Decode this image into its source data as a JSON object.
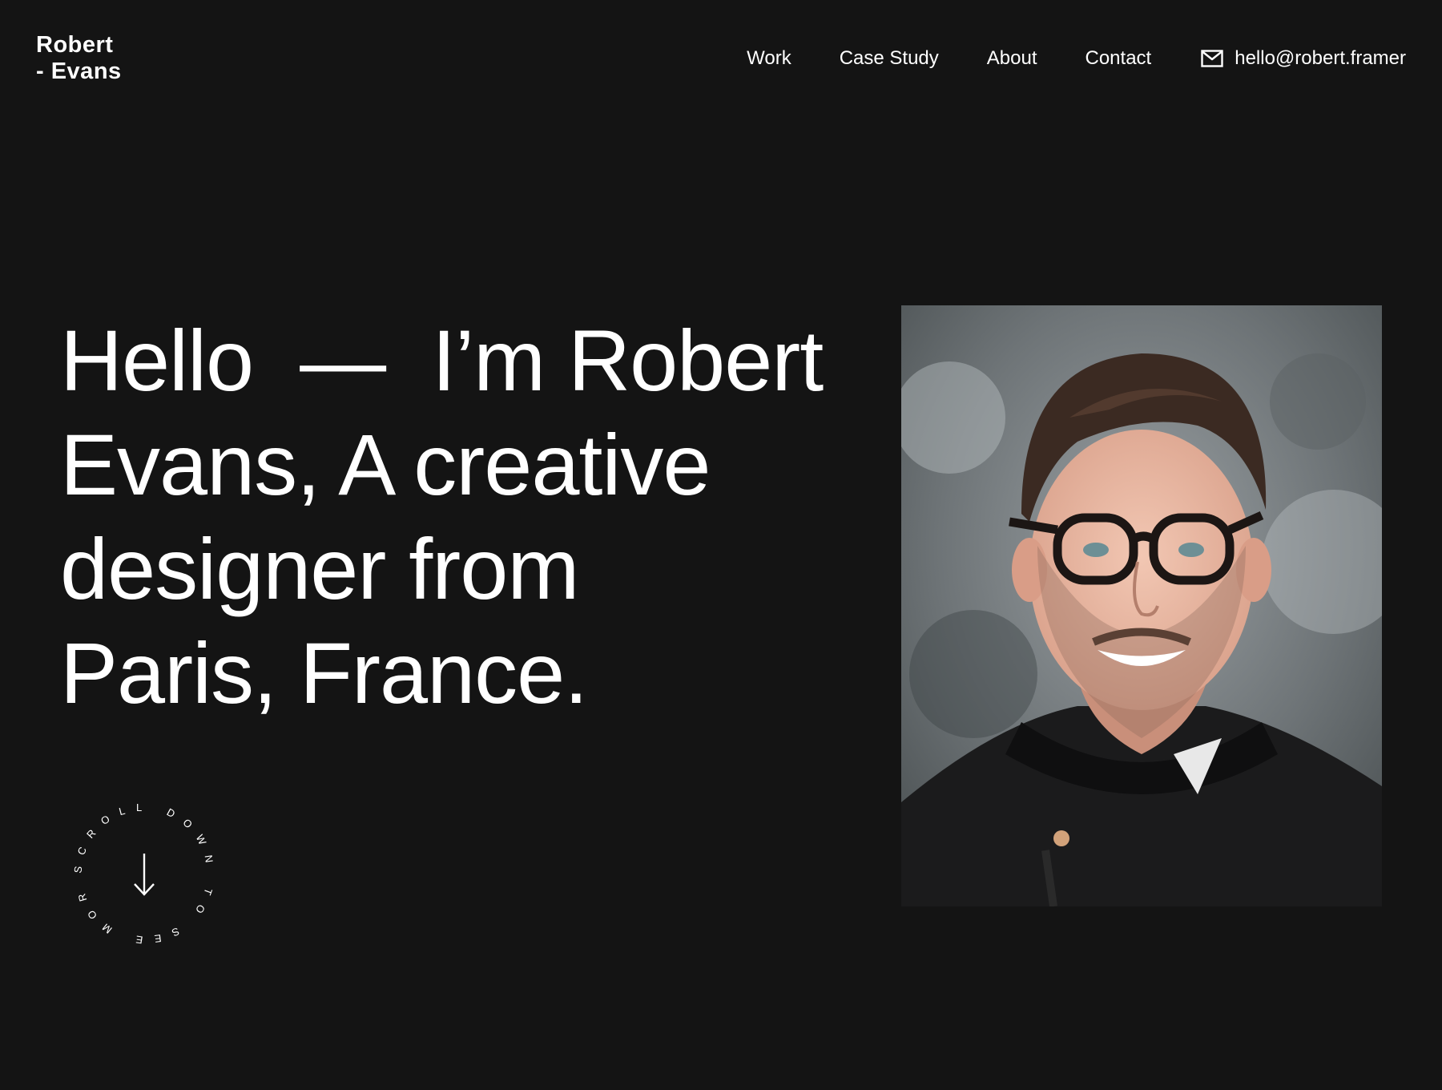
{
  "logo": {
    "line1": "Robert",
    "line2": "- Evans"
  },
  "nav": {
    "items": [
      {
        "label": "Work"
      },
      {
        "label": "Case Study"
      },
      {
        "label": "About"
      },
      {
        "label": "Contact"
      }
    ],
    "email": "hello@robert.framer",
    "email_icon": "mail-icon"
  },
  "hero": {
    "line1": "Hello  —  I’m Robert",
    "line2": "Evans, A creative",
    "line3": "designer from",
    "line4": "Paris, France."
  },
  "scroll_badge": {
    "text": "SCROLL DOWN TO SEE MORE",
    "icon": "arrow-down-icon"
  },
  "colors": {
    "background": "#141414",
    "text": "#ffffff"
  }
}
